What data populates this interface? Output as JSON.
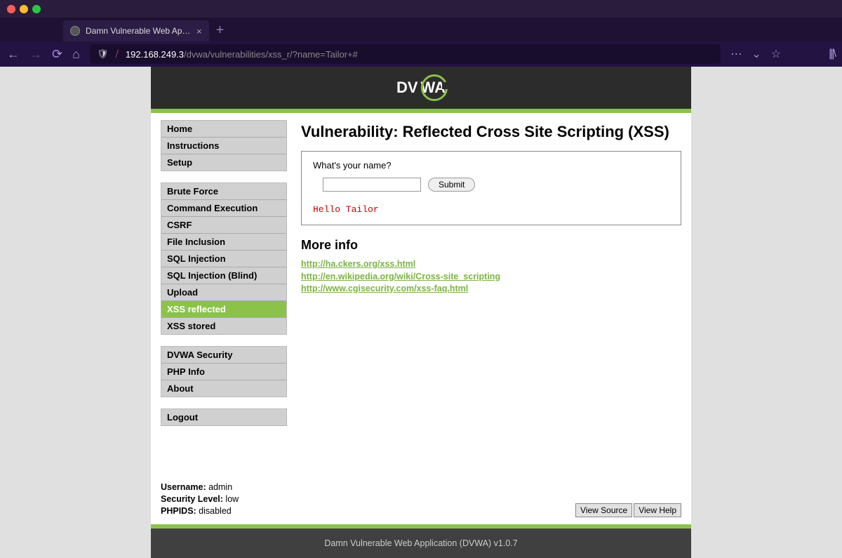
{
  "browser": {
    "tab_title": "Damn Vulnerable Web App (DV",
    "url_host": "192.168.249.3",
    "url_path": "/dvwa/vulnerabilities/xss_r/?name=Tailor+#"
  },
  "logo_text": "DVWA",
  "sidebar": {
    "group1": [
      "Home",
      "Instructions",
      "Setup"
    ],
    "group2": [
      "Brute Force",
      "Command Execution",
      "CSRF",
      "File Inclusion",
      "SQL Injection",
      "SQL Injection (Blind)",
      "Upload",
      "XSS reflected",
      "XSS stored"
    ],
    "group2_active_index": 7,
    "group3": [
      "DVWA Security",
      "PHP Info",
      "About"
    ],
    "group4": [
      "Logout"
    ]
  },
  "content": {
    "heading": "Vulnerability: Reflected Cross Site Scripting (XSS)",
    "prompt": "What's your name?",
    "submit_label": "Submit",
    "output": "Hello Tailor",
    "moreinfo_heading": "More info",
    "links": [
      "http://ha.ckers.org/xss.html",
      "http://en.wikipedia.org/wiki/Cross-site_scripting",
      "http://www.cgisecurity.com/xss-faq.html"
    ]
  },
  "status": {
    "username_label": "Username:",
    "username_value": " admin",
    "seclevel_label": "Security Level:",
    "seclevel_value": " low",
    "phpids_label": "PHPIDS:",
    "phpids_value": " disabled"
  },
  "buttons": {
    "view_source": "View Source",
    "view_help": "View Help"
  },
  "footer": "Damn Vulnerable Web Application (DVWA) v1.0.7"
}
